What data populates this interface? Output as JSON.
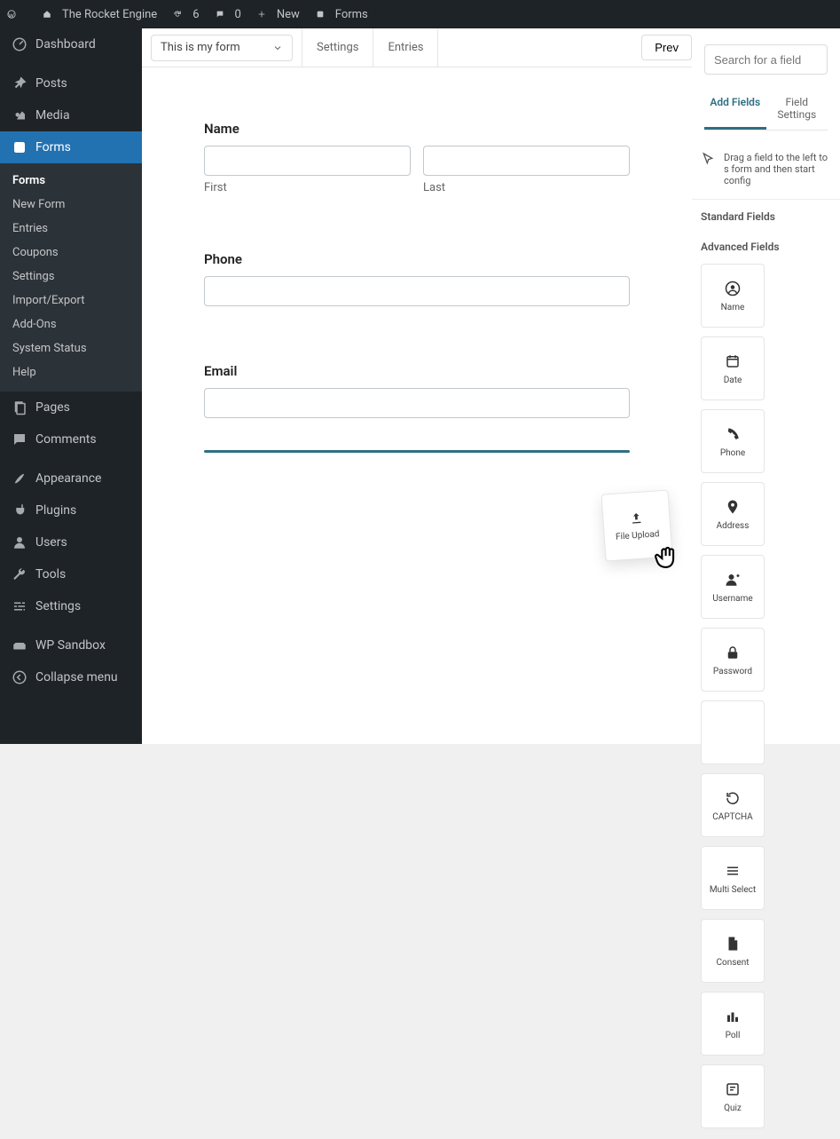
{
  "adminbar": {
    "site_name": "The Rocket Engine",
    "updates_count": "6",
    "comments_count": "0",
    "new_label": "New",
    "context_label": "Forms"
  },
  "sidebar": {
    "items": [
      {
        "label": "Dashboard"
      },
      {
        "label": "Posts"
      },
      {
        "label": "Media"
      },
      {
        "label": "Forms"
      },
      {
        "label": "Pages"
      },
      {
        "label": "Comments"
      },
      {
        "label": "Appearance"
      },
      {
        "label": "Plugins"
      },
      {
        "label": "Users"
      },
      {
        "label": "Tools"
      },
      {
        "label": "Settings"
      },
      {
        "label": "WP Sandbox"
      },
      {
        "label": "Collapse menu"
      }
    ],
    "submenu": {
      "forms": {
        "label": "Forms"
      },
      "new_form": {
        "label": "New Form"
      },
      "entries": {
        "label": "Entries"
      },
      "coupons": {
        "label": "Coupons"
      },
      "settings": {
        "label": "Settings"
      },
      "import_export": {
        "label": "Import/Export"
      },
      "addons": {
        "label": "Add-Ons"
      },
      "system_status": {
        "label": "System Status"
      },
      "help": {
        "label": "Help"
      }
    }
  },
  "editor": {
    "form_selector": "This is my form",
    "tabs": {
      "settings": "Settings",
      "entries": "Entries"
    },
    "preview_label": "Prev",
    "fields": {
      "name": {
        "label": "Name",
        "first": "First",
        "last": "Last"
      },
      "phone": {
        "label": "Phone"
      },
      "email": {
        "label": "Email"
      }
    },
    "dragging_tile": "File Upload"
  },
  "right_panel": {
    "search_placeholder": "Search for a field",
    "tabs": {
      "add": "Add Fields",
      "settings": "Field Settings"
    },
    "hint": "Drag a field to the left to s form and then start config",
    "sections": {
      "standard": "Standard Fields",
      "advanced": "Advanced Fields"
    },
    "tiles": [
      {
        "label": "Name"
      },
      {
        "label": "Date"
      },
      {
        "label": "Phone"
      },
      {
        "label": "Address"
      },
      {
        "label": "Username"
      },
      {
        "label": "Password"
      },
      {
        "label": ""
      },
      {
        "label": "CAPTCHA"
      },
      {
        "label": "Multi Select"
      },
      {
        "label": "Consent"
      },
      {
        "label": "Poll"
      },
      {
        "label": "Quiz"
      }
    ]
  }
}
